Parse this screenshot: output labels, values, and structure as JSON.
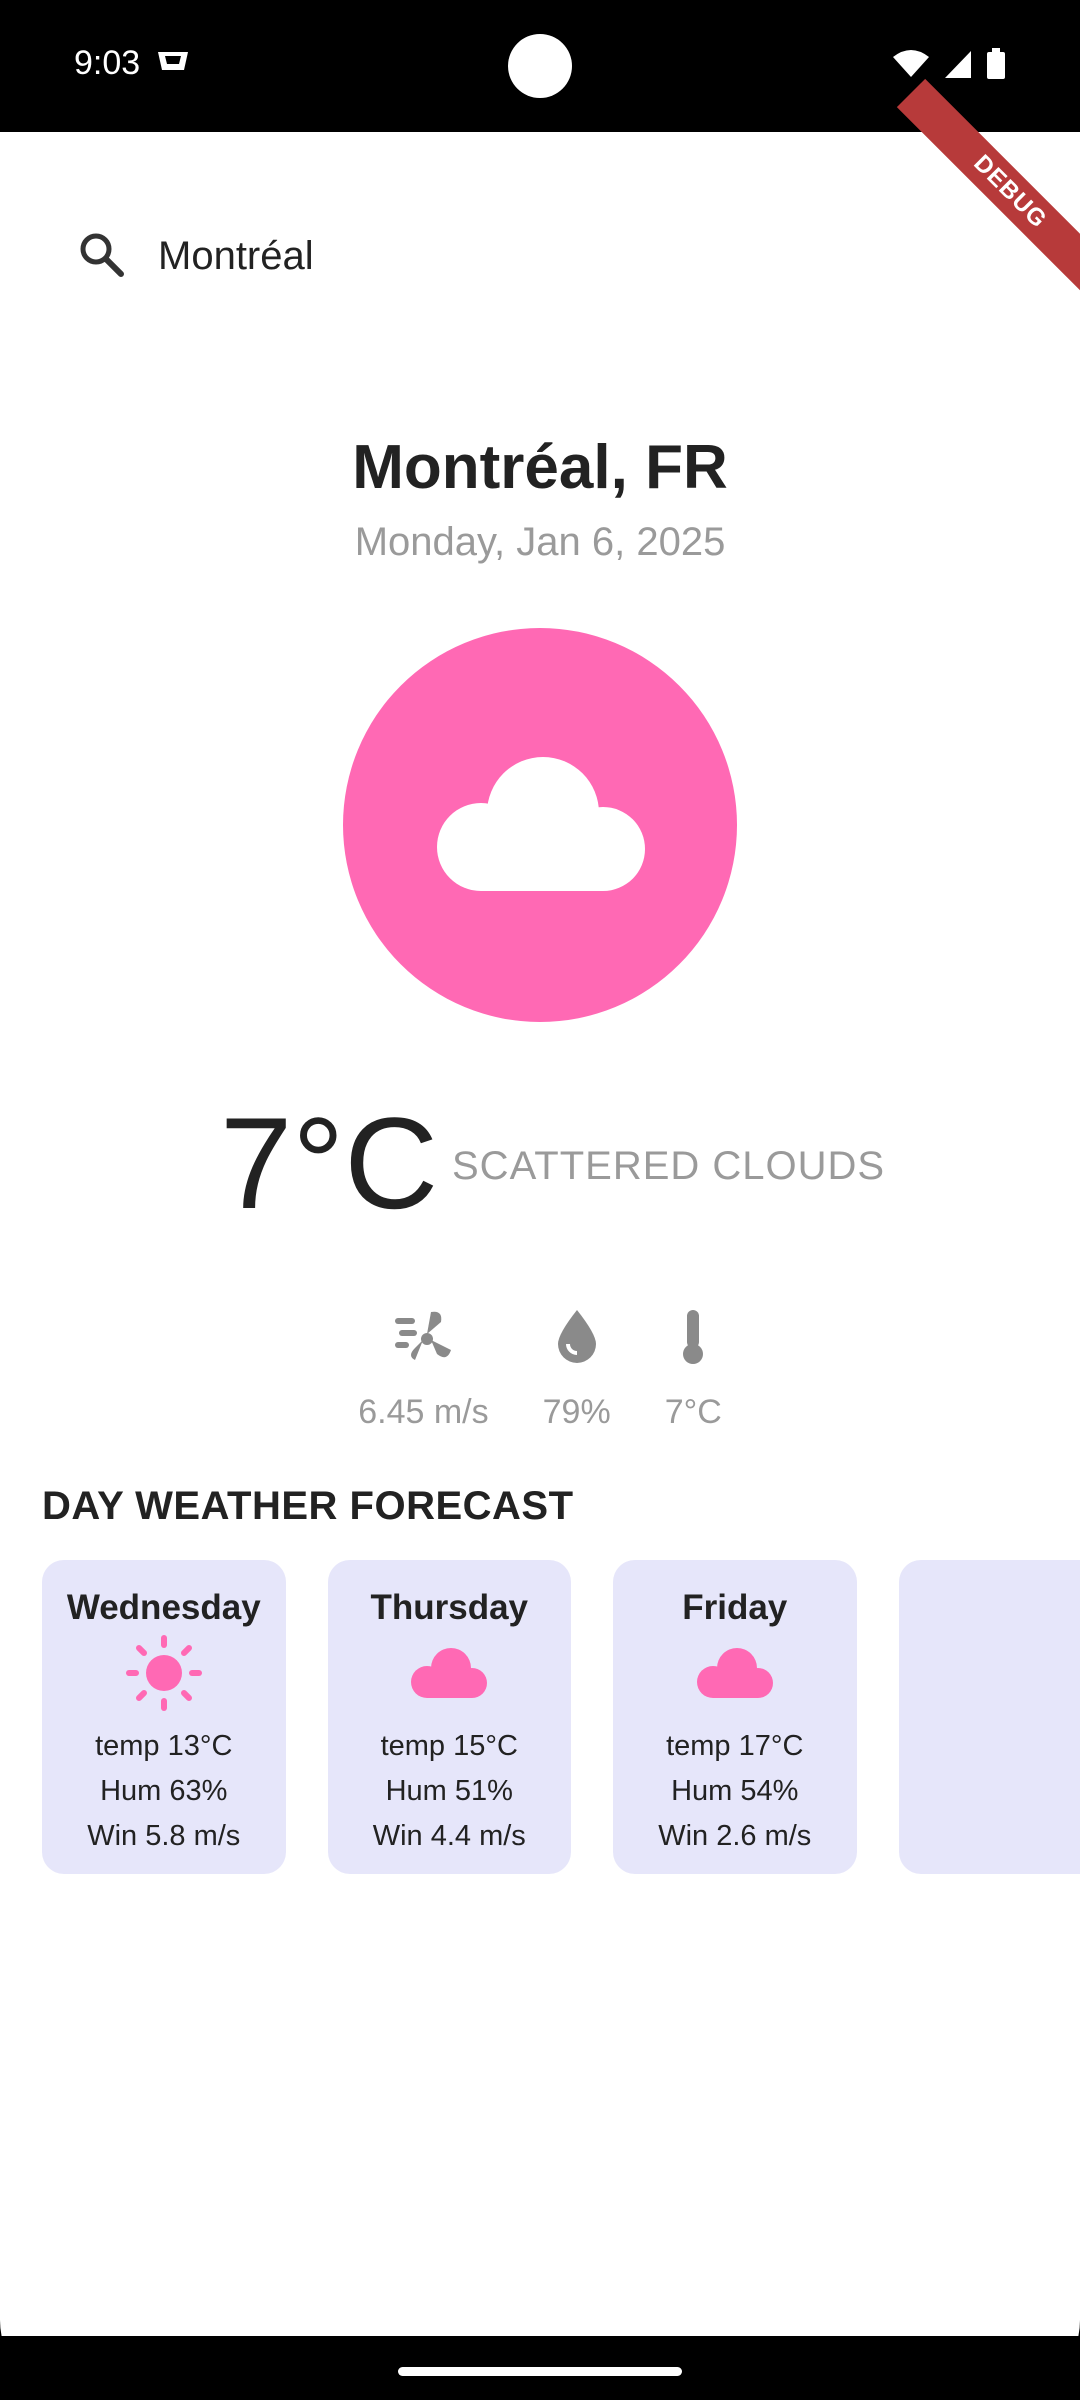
{
  "status_bar": {
    "time": "9:03",
    "icons": [
      "notification-icon",
      "wifi-icon",
      "signal-icon",
      "battery-icon"
    ]
  },
  "debug_banner": "DEBUG",
  "search": {
    "value": "Montréal",
    "icon": "search-icon"
  },
  "current": {
    "city": "Montréal, FR",
    "date": "Monday, Jan 6, 2025",
    "icon": "cloud-icon",
    "temperature": "7°C",
    "description": "SCATTERED CLOUDS",
    "stats": [
      {
        "icon": "wind-icon",
        "value": "6.45 m/s"
      },
      {
        "icon": "humidity-icon",
        "value": "79%"
      },
      {
        "icon": "thermometer-icon",
        "value": "7°C"
      }
    ]
  },
  "forecast": {
    "title": "DAY WEATHER FORECAST",
    "days": [
      {
        "day": "Wednesday",
        "icon": "sun-icon",
        "temp": "temp 13°C",
        "hum": "Hum 63%",
        "wind": "Win 5.8 m/s"
      },
      {
        "day": "Thursday",
        "icon": "cloud-icon",
        "temp": "temp 15°C",
        "hum": "Hum 51%",
        "wind": "Win 4.4 m/s"
      },
      {
        "day": "Friday",
        "icon": "cloud-icon",
        "temp": "temp 17°C",
        "hum": "Hum 54%",
        "wind": "Win 2.6 m/s"
      }
    ]
  },
  "colors": {
    "accent": "#ff69b4",
    "card_bg": "#e6e6fa",
    "muted_text": "#9a9a9a",
    "debug_banner": "#b73a3a"
  }
}
